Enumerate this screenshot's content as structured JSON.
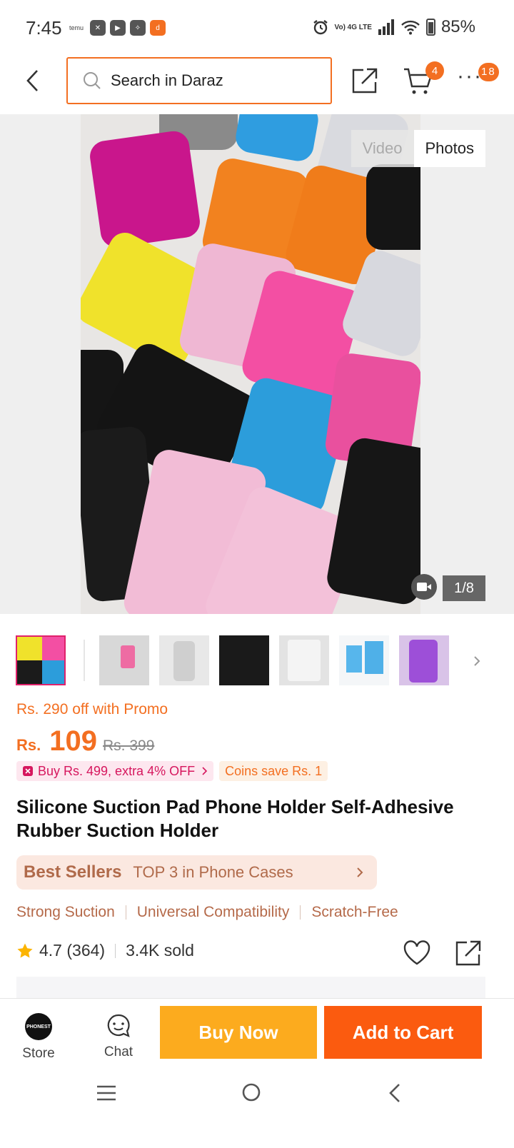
{
  "status_bar": {
    "time": "7:45",
    "app_icons": [
      "temu-icon",
      "capcut-icon",
      "youtube-icon",
      "app-icon",
      "daraz-icon"
    ],
    "network": "Vo) 4G LTE",
    "battery": "85%"
  },
  "header": {
    "search_placeholder": "Search in Daraz",
    "cart_count": "4",
    "more_count": "18"
  },
  "gallery": {
    "tabs": [
      "Video",
      "Photos"
    ],
    "active_tab": "Photos",
    "counter": "1/8",
    "thumbnail_count": 7
  },
  "product": {
    "promo_text": "Rs. 290 off with Promo",
    "currency": "Rs.",
    "price": "109",
    "old_price": "Rs. 399",
    "voucher_chip": "Buy Rs. 499, extra 4% OFF",
    "coins_chip": "Coins save Rs. 1",
    "title": "Silicone Suction Pad Phone Holder Self-Adhesive Rubber Suction Holder",
    "bestseller_label": "Best Sellers",
    "bestseller_rank": "TOP 3 in Phone Cases",
    "features": [
      "Strong Suction",
      "Universal Compatibility",
      "Scratch-Free"
    ],
    "rating": "4.7 (364)",
    "sold": "3.4K sold"
  },
  "action_bar": {
    "store_label": "Store",
    "store_logo_text": "PHONEST",
    "chat_label": "Chat",
    "buy_now_label": "Buy Now",
    "add_to_cart_label": "Add to Cart"
  },
  "colors": {
    "accent": "#f36f21",
    "buy_now": "#fcab1e",
    "add_to_cart": "#fb5b0f",
    "bestseller_bg": "#fbe8e0",
    "bestseller_text": "#b06a4a"
  }
}
